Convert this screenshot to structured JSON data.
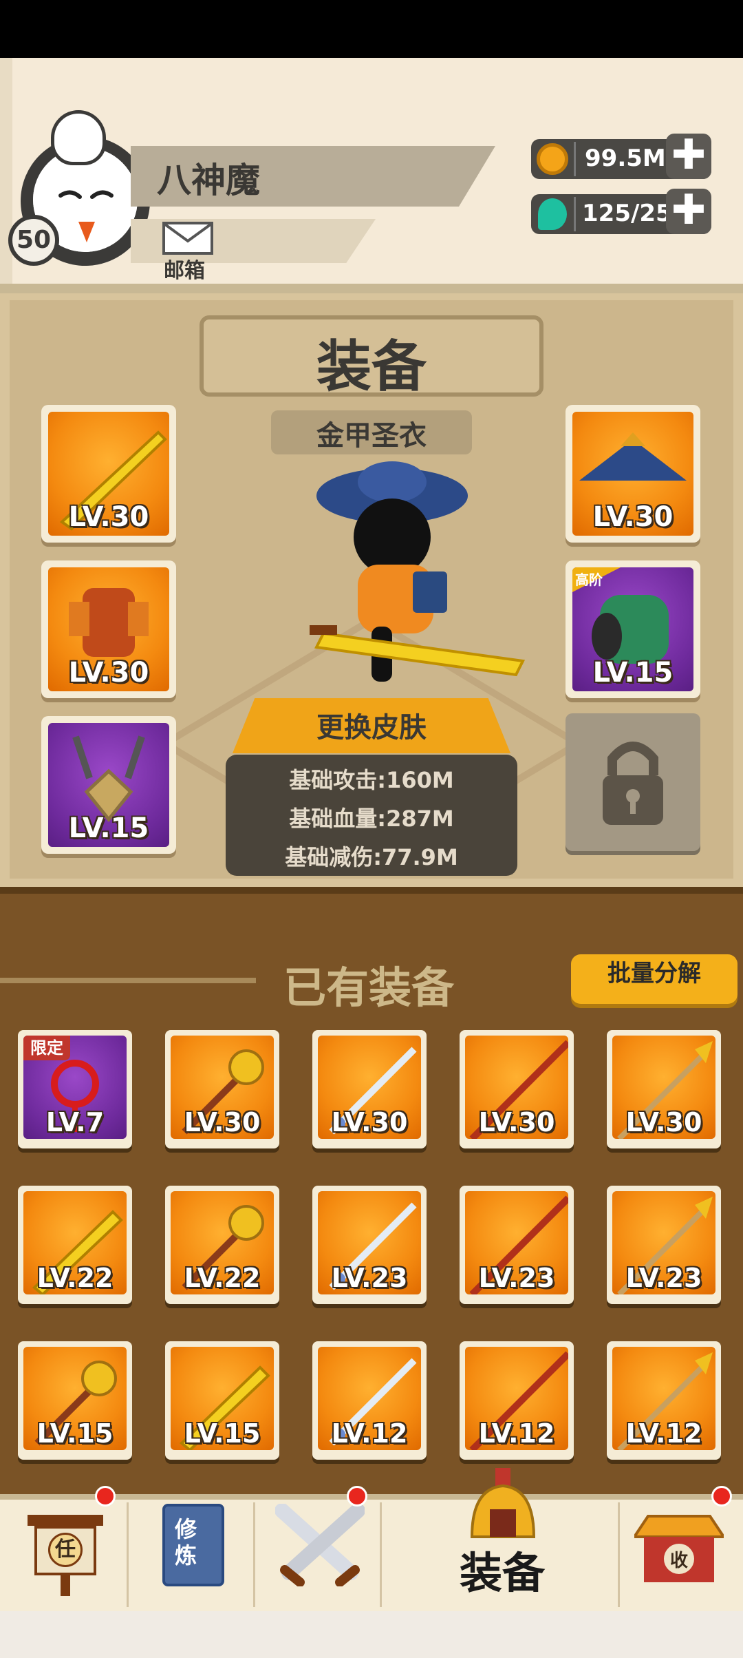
{
  "player": {
    "name": "八神魔",
    "level": "50",
    "mail_label": "邮箱"
  },
  "resources": {
    "gold": "99.5M",
    "gems": "125/25",
    "add_symbol": "✚"
  },
  "equipment": {
    "title": "装备",
    "armor_name": "金甲圣衣",
    "skin_button": "更换皮肤",
    "stats": [
      "基础攻击:160M",
      "基础血量:287M",
      "基础减伤:77.9M"
    ],
    "left_slots": [
      "LV.30",
      "LV.30",
      "LV.15"
    ],
    "right_slots": [
      "LV.30",
      "LV.15"
    ],
    "right_slot_tag": "高阶"
  },
  "owned": {
    "title": "已有装备",
    "batch_button": "批量分解",
    "limited_tag": "限定",
    "items": [
      "LV.7",
      "LV.30",
      "LV.30",
      "LV.30",
      "LV.30",
      "LV.22",
      "LV.22",
      "LV.23",
      "LV.23",
      "LV.23",
      "LV.15",
      "LV.15",
      "LV.12",
      "LV.12",
      "LV.12"
    ]
  },
  "nav": {
    "tasks_char": "任",
    "cultivate_chars": "修炼",
    "equip_label": "装备",
    "shop_char": "收"
  }
}
